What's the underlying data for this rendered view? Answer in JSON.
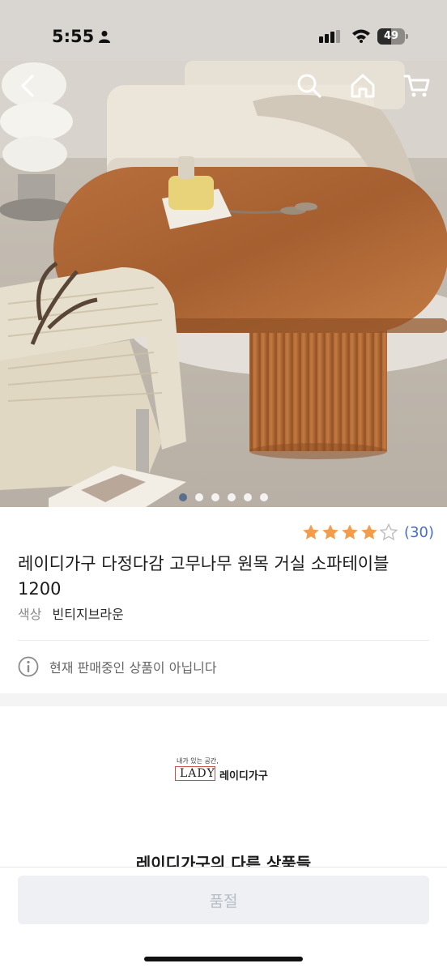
{
  "status_bar": {
    "time": "5:55",
    "battery_level": "49",
    "battery_fraction": 0.49,
    "icons": [
      "person-icon",
      "signal-icon",
      "wifi-icon",
      "battery-icon"
    ]
  },
  "header": {
    "icons": [
      "back-arrow-icon",
      "search-icon",
      "home-icon",
      "cart-icon"
    ]
  },
  "gallery": {
    "image": "oval wooden coffee table with fluted base in living room",
    "page_count": 6,
    "current_page": 1
  },
  "product": {
    "rating": 4,
    "rating_max": 5,
    "review_count": "(30)",
    "title": "레이디가구 다정다감 고무나무 원목 거실 소파테이블 1200",
    "option_label": "색상",
    "option_value": "빈티지브라운",
    "notice_text": "현재 판매중인 상품이 아닙니다"
  },
  "seller": {
    "logo_tagline": "내가 있는 공간,",
    "logo_brand": "LADY",
    "logo_name": "레이디가구",
    "other_products_heading": "레이디가구의 다른 상품들"
  },
  "bottom": {
    "soldout_label": "품절"
  },
  "colors": {
    "star": "#f39c4a",
    "review_link": "#4a6ec2",
    "dot_active": "#5a6f8c",
    "soldout_bg": "#eef0f4"
  }
}
